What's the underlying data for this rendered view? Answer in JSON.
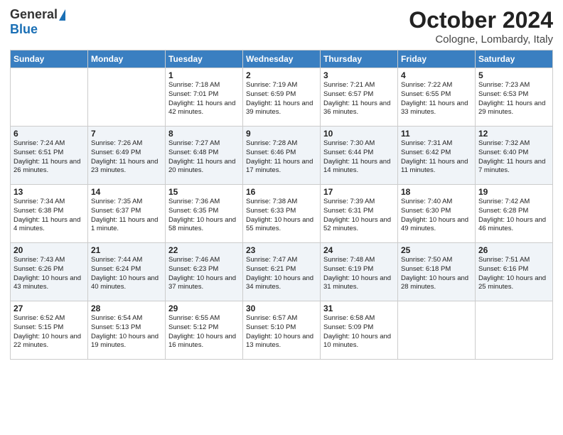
{
  "header": {
    "logo_general": "General",
    "logo_blue": "Blue",
    "month_title": "October 2024",
    "location": "Cologne, Lombardy, Italy"
  },
  "days_of_week": [
    "Sunday",
    "Monday",
    "Tuesday",
    "Wednesday",
    "Thursday",
    "Friday",
    "Saturday"
  ],
  "weeks": [
    [
      {
        "day": "",
        "info": ""
      },
      {
        "day": "",
        "info": ""
      },
      {
        "day": "1",
        "info": "Sunrise: 7:18 AM\nSunset: 7:01 PM\nDaylight: 11 hours and 42 minutes."
      },
      {
        "day": "2",
        "info": "Sunrise: 7:19 AM\nSunset: 6:59 PM\nDaylight: 11 hours and 39 minutes."
      },
      {
        "day": "3",
        "info": "Sunrise: 7:21 AM\nSunset: 6:57 PM\nDaylight: 11 hours and 36 minutes."
      },
      {
        "day": "4",
        "info": "Sunrise: 7:22 AM\nSunset: 6:55 PM\nDaylight: 11 hours and 33 minutes."
      },
      {
        "day": "5",
        "info": "Sunrise: 7:23 AM\nSunset: 6:53 PM\nDaylight: 11 hours and 29 minutes."
      }
    ],
    [
      {
        "day": "6",
        "info": "Sunrise: 7:24 AM\nSunset: 6:51 PM\nDaylight: 11 hours and 26 minutes."
      },
      {
        "day": "7",
        "info": "Sunrise: 7:26 AM\nSunset: 6:49 PM\nDaylight: 11 hours and 23 minutes."
      },
      {
        "day": "8",
        "info": "Sunrise: 7:27 AM\nSunset: 6:48 PM\nDaylight: 11 hours and 20 minutes."
      },
      {
        "day": "9",
        "info": "Sunrise: 7:28 AM\nSunset: 6:46 PM\nDaylight: 11 hours and 17 minutes."
      },
      {
        "day": "10",
        "info": "Sunrise: 7:30 AM\nSunset: 6:44 PM\nDaylight: 11 hours and 14 minutes."
      },
      {
        "day": "11",
        "info": "Sunrise: 7:31 AM\nSunset: 6:42 PM\nDaylight: 11 hours and 11 minutes."
      },
      {
        "day": "12",
        "info": "Sunrise: 7:32 AM\nSunset: 6:40 PM\nDaylight: 11 hours and 7 minutes."
      }
    ],
    [
      {
        "day": "13",
        "info": "Sunrise: 7:34 AM\nSunset: 6:38 PM\nDaylight: 11 hours and 4 minutes."
      },
      {
        "day": "14",
        "info": "Sunrise: 7:35 AM\nSunset: 6:37 PM\nDaylight: 11 hours and 1 minute."
      },
      {
        "day": "15",
        "info": "Sunrise: 7:36 AM\nSunset: 6:35 PM\nDaylight: 10 hours and 58 minutes."
      },
      {
        "day": "16",
        "info": "Sunrise: 7:38 AM\nSunset: 6:33 PM\nDaylight: 10 hours and 55 minutes."
      },
      {
        "day": "17",
        "info": "Sunrise: 7:39 AM\nSunset: 6:31 PM\nDaylight: 10 hours and 52 minutes."
      },
      {
        "day": "18",
        "info": "Sunrise: 7:40 AM\nSunset: 6:30 PM\nDaylight: 10 hours and 49 minutes."
      },
      {
        "day": "19",
        "info": "Sunrise: 7:42 AM\nSunset: 6:28 PM\nDaylight: 10 hours and 46 minutes."
      }
    ],
    [
      {
        "day": "20",
        "info": "Sunrise: 7:43 AM\nSunset: 6:26 PM\nDaylight: 10 hours and 43 minutes."
      },
      {
        "day": "21",
        "info": "Sunrise: 7:44 AM\nSunset: 6:24 PM\nDaylight: 10 hours and 40 minutes."
      },
      {
        "day": "22",
        "info": "Sunrise: 7:46 AM\nSunset: 6:23 PM\nDaylight: 10 hours and 37 minutes."
      },
      {
        "day": "23",
        "info": "Sunrise: 7:47 AM\nSunset: 6:21 PM\nDaylight: 10 hours and 34 minutes."
      },
      {
        "day": "24",
        "info": "Sunrise: 7:48 AM\nSunset: 6:19 PM\nDaylight: 10 hours and 31 minutes."
      },
      {
        "day": "25",
        "info": "Sunrise: 7:50 AM\nSunset: 6:18 PM\nDaylight: 10 hours and 28 minutes."
      },
      {
        "day": "26",
        "info": "Sunrise: 7:51 AM\nSunset: 6:16 PM\nDaylight: 10 hours and 25 minutes."
      }
    ],
    [
      {
        "day": "27",
        "info": "Sunrise: 6:52 AM\nSunset: 5:15 PM\nDaylight: 10 hours and 22 minutes."
      },
      {
        "day": "28",
        "info": "Sunrise: 6:54 AM\nSunset: 5:13 PM\nDaylight: 10 hours and 19 minutes."
      },
      {
        "day": "29",
        "info": "Sunrise: 6:55 AM\nSunset: 5:12 PM\nDaylight: 10 hours and 16 minutes."
      },
      {
        "day": "30",
        "info": "Sunrise: 6:57 AM\nSunset: 5:10 PM\nDaylight: 10 hours and 13 minutes."
      },
      {
        "day": "31",
        "info": "Sunrise: 6:58 AM\nSunset: 5:09 PM\nDaylight: 10 hours and 10 minutes."
      },
      {
        "day": "",
        "info": ""
      },
      {
        "day": "",
        "info": ""
      }
    ]
  ]
}
